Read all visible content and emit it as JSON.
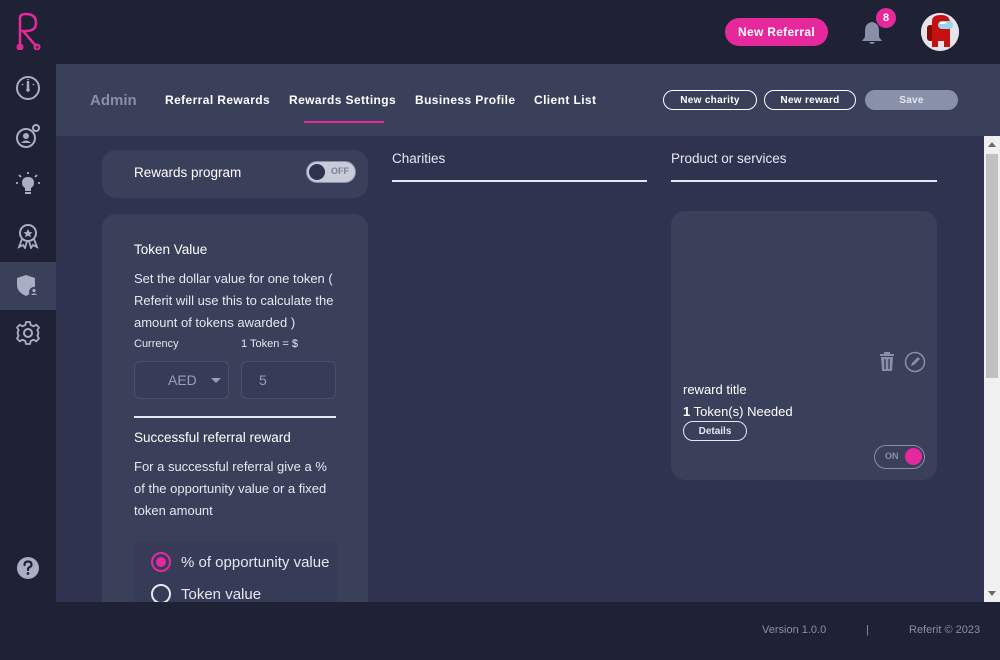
{
  "header": {
    "new_referral_label": "New Referral",
    "notification_count": "8",
    "bell_icon": "bell-icon",
    "avatar_icon": "avatar-among-us"
  },
  "sidebar": {
    "items": [
      {
        "icon": "dashboard-gauge-icon"
      },
      {
        "icon": "referral-network-icon"
      },
      {
        "icon": "lightbulb-icon"
      },
      {
        "icon": "award-badge-icon"
      },
      {
        "icon": "shield-user-icon"
      },
      {
        "icon": "gear-icon"
      }
    ],
    "bottom": [
      {
        "icon": "help-icon"
      },
      {
        "icon": "info-icon"
      }
    ]
  },
  "subheader": {
    "admin_label": "Admin",
    "tabs": [
      {
        "label": "Referral Rewards"
      },
      {
        "label": "Rewards Settings"
      },
      {
        "label": "Business Profile"
      },
      {
        "label": "Client List"
      }
    ],
    "buttons": {
      "new_charity": "New charity",
      "new_reward": "New reward",
      "save": "Save"
    }
  },
  "rewards_program": {
    "label": "Rewards program",
    "toggle_text": "OFF"
  },
  "token_value": {
    "title": "Token Value",
    "description": "Set the dollar value for one token ( Referit will use this to calculate the amount of tokens awarded )",
    "currency_label": "Currency",
    "token_label": "1 Token = $",
    "currency_value": "AED",
    "token_amount": "5"
  },
  "successful_referral": {
    "title": "Successful referral reward",
    "description": "For a successful referral give a % of the opportunity value or a fixed token amount",
    "options": [
      {
        "label": "% of opportunity value",
        "selected": true
      },
      {
        "label": "Token value",
        "selected": false
      }
    ]
  },
  "charities": {
    "title": "Charities"
  },
  "products": {
    "title": "Product or services",
    "card": {
      "title": "reward title",
      "tokens_count": "1",
      "tokens_suffix": " Token(s) Needed",
      "details_label": "Details",
      "toggle_text": "ON"
    }
  },
  "footer": {
    "version": "Version 1.0.0",
    "separator": "|",
    "copyright": "Referit © 2023"
  },
  "colors": {
    "accent": "#e5299d",
    "background": "#1f2235",
    "panel": "#2f3350",
    "card": "#3a3f5a"
  }
}
